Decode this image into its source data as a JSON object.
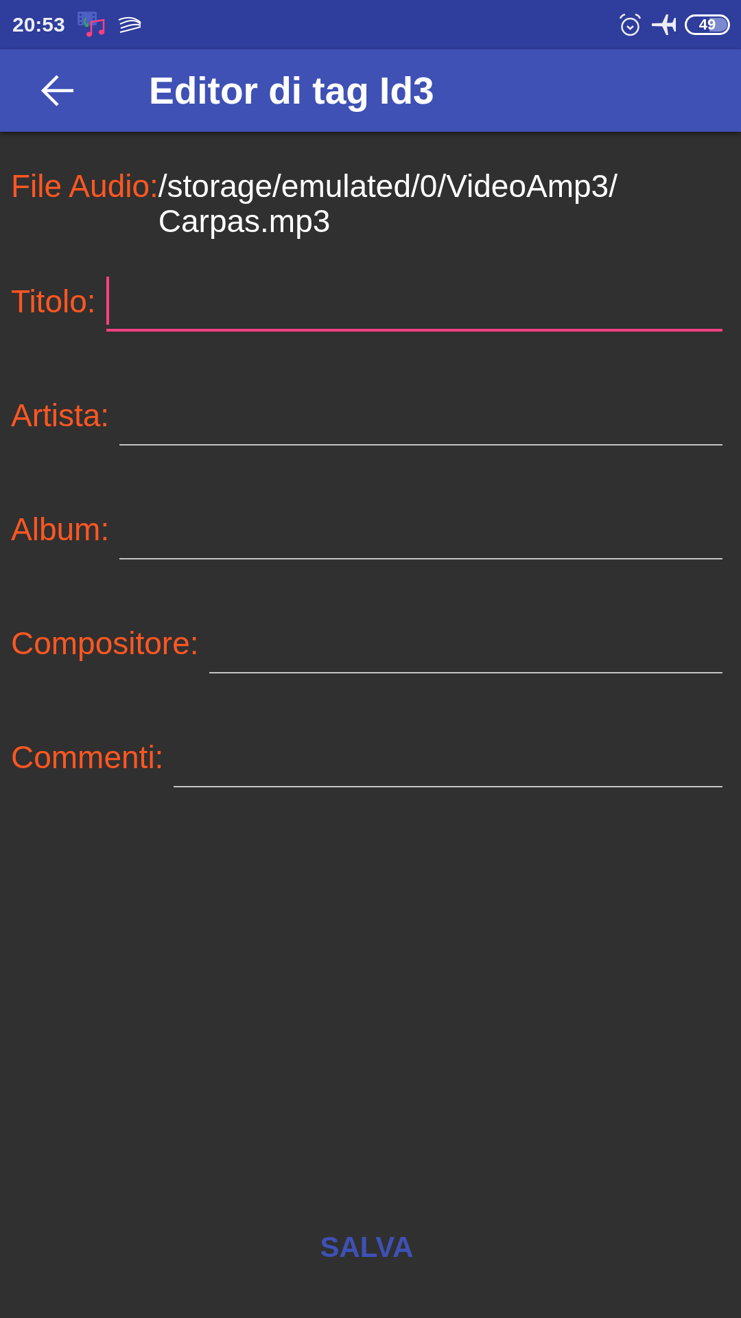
{
  "status_bar": {
    "time": "20:53",
    "battery": "49"
  },
  "app_bar": {
    "title": "Editor di tag Id3"
  },
  "file": {
    "label": "File Audio:",
    "path": "/storage/emulated/0/VideoAmp3/Carpas.mp3"
  },
  "fields": [
    {
      "label": "Titolo:",
      "focused": true
    },
    {
      "label": "Artista:",
      "focused": false
    },
    {
      "label": "Album:",
      "focused": false
    },
    {
      "label": "Compositore:",
      "focused": false
    },
    {
      "label": "Commenti:",
      "focused": false
    }
  ],
  "save_button": {
    "label": "SALVA"
  }
}
